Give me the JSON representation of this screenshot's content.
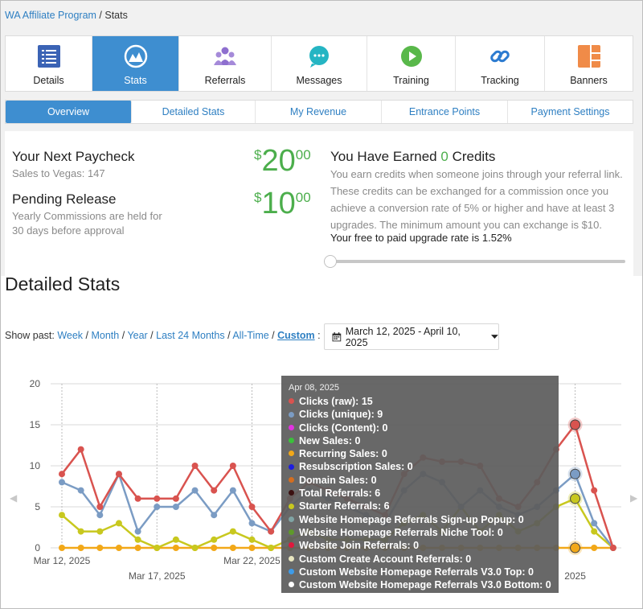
{
  "breadcrumb": {
    "link": "WA Affiliate Program",
    "sep": " / ",
    "current": "Stats"
  },
  "tabs": [
    {
      "label": "Details",
      "icon": "list-icon"
    },
    {
      "label": "Stats",
      "icon": "gauge-icon",
      "active": true
    },
    {
      "label": "Referrals",
      "icon": "users-icon"
    },
    {
      "label": "Messages",
      "icon": "chat-bubble-icon"
    },
    {
      "label": "Training",
      "icon": "play-icon"
    },
    {
      "label": "Tracking",
      "icon": "link-icon"
    },
    {
      "label": "Banners",
      "icon": "layout-icon"
    }
  ],
  "subtabs": [
    {
      "label": "Overview",
      "active": true
    },
    {
      "label": "Detailed Stats"
    },
    {
      "label": "My Revenue"
    },
    {
      "label": "Entrance Points"
    },
    {
      "label": "Payment Settings"
    }
  ],
  "paycheck": {
    "title": "Your Next Paycheck",
    "sub": "Sales to Vegas: 147",
    "currency": "$",
    "whole": "20",
    "cents": "00"
  },
  "pending": {
    "title": "Pending Release",
    "sub": "Yearly Commissions are held for 30 days before approval",
    "currency": "$",
    "whole": "10",
    "cents": "00"
  },
  "credits": {
    "title_prefix": "You Have Earned ",
    "count": "0",
    "title_suffix": " Credits",
    "desc": "You earn credits when someone joins through your referral link. These credits can be exchanged for a commission once you achieve a conversion rate of 5% or higher and have at least 3 upgrades. The minimum amount you can exchange is $10.",
    "rate": "Your free to paid upgrade rate is 1.52%",
    "slider_value": 0
  },
  "detailed_stats": {
    "title": "Detailed Stats",
    "show_past_label": "Show past:",
    "ranges": [
      "Week",
      "Month",
      "Year",
      "Last 24 Months",
      "All-Time",
      "Custom"
    ],
    "selected_range": "Custom",
    "trailing": " :",
    "date_range": "March 12, 2025 - April 10, 2025"
  },
  "tooltip": {
    "date": "Apr 08, 2025",
    "rows": [
      {
        "label": "Clicks (raw):",
        "value": "15",
        "color": "#d9534f"
      },
      {
        "label": "Clicks (unique):",
        "value": "9",
        "color": "#7b9cc4"
      },
      {
        "label": "Clicks (Content):",
        "value": "0",
        "color": "#e233e2"
      },
      {
        "label": "New Sales:",
        "value": "0",
        "color": "#3bc13b"
      },
      {
        "label": "Recurring Sales:",
        "value": "0",
        "color": "#f2a818"
      },
      {
        "label": "Resubscription Sales:",
        "value": "0",
        "color": "#1d1de0"
      },
      {
        "label": "Domain Sales:",
        "value": "0",
        "color": "#d46e1f"
      },
      {
        "label": "Total Referrals:",
        "value": "6",
        "color": "#3b1010"
      },
      {
        "label": "Starter Referrals:",
        "value": "6",
        "color": "#c8c81f"
      },
      {
        "label": "Website Homepage Referrals Sign-up Popup:",
        "value": "0",
        "color": "#7fa4a4"
      },
      {
        "label": "Website Homepage Referrals Niche Tool:",
        "value": "0",
        "color": "#5f9a2a"
      },
      {
        "label": "Website Join Referrals:",
        "value": "0",
        "color": "#e0183d"
      },
      {
        "label": "Custom Create Account Referrals:",
        "value": "0",
        "color": "#e8e6c0"
      },
      {
        "label": "Custom Website Homepage Referrals V3.0 Top:",
        "value": "0",
        "color": "#3e9be8"
      },
      {
        "label": "Custom Website Homepage Referrals V3.0 Bottom:",
        "value": "0",
        "color": "#ffffff"
      }
    ]
  },
  "chart_data": {
    "type": "line",
    "ylim": [
      0,
      20
    ],
    "yticks": [
      "0",
      "5",
      "10",
      "15",
      "20"
    ],
    "x_labels": [
      {
        "index": 0,
        "label": "Mar 12, 2025"
      },
      {
        "index": 5,
        "label": "Mar 17, 2025"
      },
      {
        "index": 10,
        "label": "Mar 22, 2025"
      },
      {
        "index": 27,
        "label": "2025"
      }
    ],
    "x": [
      "Mar 12",
      "Mar 13",
      "Mar 14",
      "Mar 15",
      "Mar 16",
      "Mar 17",
      "Mar 18",
      "Mar 19",
      "Mar 20",
      "Mar 21",
      "Mar 22",
      "Mar 23",
      "Mar 24",
      "Mar 25",
      "Mar 26",
      "Mar 27",
      "Mar 28",
      "Mar 29",
      "Mar 30",
      "Mar 31",
      "Apr 01",
      "Apr 02",
      "Apr 03",
      "Apr 04",
      "Apr 05",
      "Apr 06",
      "Apr 07",
      "Apr 08",
      "Apr 09",
      "Apr 10"
    ],
    "highlight_index": 27,
    "series": [
      {
        "name": "Clicks (raw)",
        "color": "#d9534f",
        "values": [
          9,
          12,
          5,
          9,
          6,
          6,
          6,
          10,
          7,
          10,
          5,
          2,
          6,
          8,
          7,
          6,
          5,
          4,
          9,
          11,
          10.5,
          10.5,
          10,
          6,
          5,
          8,
          12,
          15,
          7,
          0
        ]
      },
      {
        "name": "Clicks (unique)",
        "color": "#7b9cc4",
        "values": [
          8,
          7,
          4,
          9,
          2,
          5,
          5,
          7,
          4,
          7,
          3,
          2,
          5,
          7,
          6,
          5,
          4,
          3,
          7,
          9,
          8,
          5,
          7,
          5,
          4,
          5,
          7,
          9,
          3,
          0
        ]
      },
      {
        "name": "Starter Referrals",
        "color": "#c8c81f",
        "values": [
          4,
          2,
          2,
          3,
          1,
          0,
          1,
          0,
          1,
          2,
          1,
          0,
          1,
          2,
          1,
          1,
          1,
          1,
          3,
          4,
          2,
          5,
          2,
          4,
          2,
          3,
          5,
          6,
          2,
          0
        ]
      },
      {
        "name": "Recurring Sales",
        "color": "#f2a818",
        "values": [
          0,
          0,
          0,
          0,
          0,
          0,
          0,
          0,
          0,
          0,
          0,
          0,
          0,
          0,
          0,
          0,
          0,
          0,
          0,
          0,
          0,
          0,
          0,
          0,
          0,
          0,
          0,
          0,
          0,
          0
        ]
      }
    ]
  }
}
